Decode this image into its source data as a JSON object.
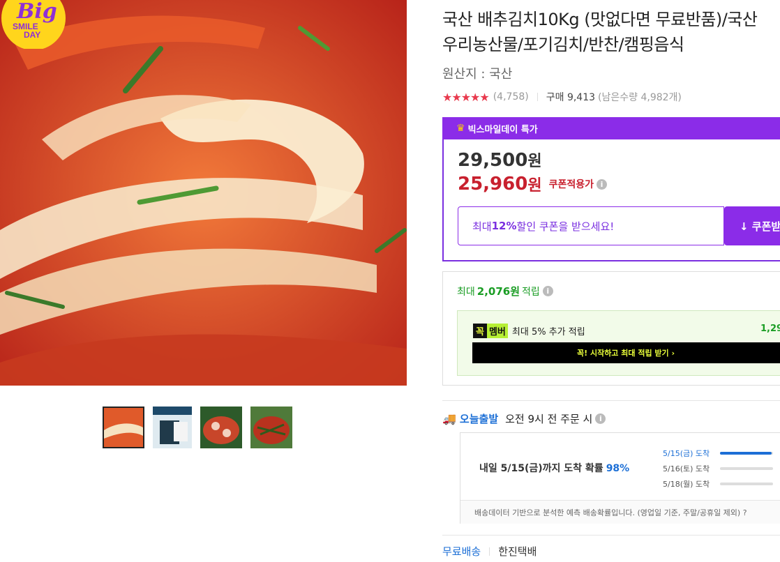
{
  "badge": {
    "line1": "Big",
    "line2": "SMILE",
    "line3": "DAY"
  },
  "product": {
    "title": "국산 배추김치10Kg (맛없다면 무료반품)/국산 우리농산물/포기김치/반찬/캠핑음식",
    "origin": "원산지 : 국산",
    "rating_stars": "★★★★★",
    "rating_value": 4.7,
    "review_count": "(4,758)",
    "purchase": "구매 9,413",
    "remaining": "(남은수량 4,982개)"
  },
  "promo": {
    "header": "빅스마일데이 특가",
    "original_price": "29,500",
    "sale_price": "25,960",
    "won": "원",
    "coupon_note": "쿠폰적용가",
    "coupon_prefix": "최대 ",
    "coupon_pct": "12%",
    "coupon_suffix": " 할인 쿠폰을 받으세요!",
    "coupon_button": "↓ 쿠폰받"
  },
  "points": {
    "prefix": "최대",
    "amount": "2,076원",
    "suffix": "적립",
    "member_logo1": "꼭",
    "member_logo2": "멤버",
    "member_text": "최대 5% 추가 적립",
    "member_amount": "1,29",
    "member_button": "꼭! 시작하고 최대 적립 받기 ›"
  },
  "delivery": {
    "label": "오늘출발",
    "cutoff": "오전 9시 전 주문 시",
    "probability_text": "내일 5/15(금)까지 도착 확률",
    "probability": "98%",
    "dates": [
      {
        "label": "5/15(금) 도착",
        "fill": 0.98
      },
      {
        "label": "5/16(토) 도착",
        "fill": 0.0
      },
      {
        "label": "5/18(월) 도착",
        "fill": 0.0
      }
    ],
    "footnote": "배송데이터 기반으로 분석한 예측 배송확률입니다. (영업일 기준, 주말/공휴일 제외) ?"
  },
  "shipping": {
    "free": "무료배송",
    "courier": "한진택배"
  },
  "colors": {
    "purple": "#8b2ce8",
    "red": "#c8202e",
    "green": "#1a9d24",
    "blue": "#1c6fd6"
  }
}
